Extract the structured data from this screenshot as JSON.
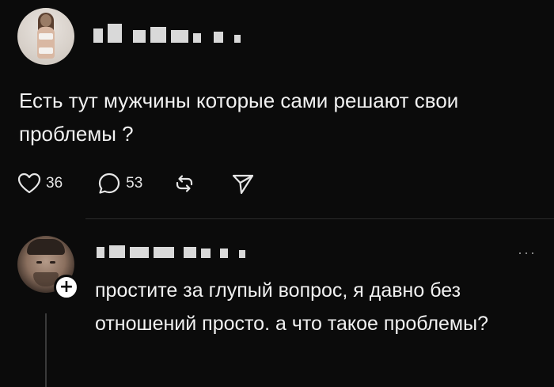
{
  "post": {
    "avatar_icon": "profile-photo",
    "text": "Есть тут мужчины которые сами решают свои проблемы ?",
    "actions": {
      "like_icon": "heart-icon",
      "like_count": "36",
      "comment_icon": "comment-bubble-icon",
      "comment_count": "53",
      "repost_icon": "repost-icon",
      "share_icon": "send-icon"
    }
  },
  "reply": {
    "avatar_icon": "profile-photo",
    "follow_icon": "plus-icon",
    "follow_label": "+",
    "more_label": "···",
    "text": "простите за глупый вопрос, я давно без отношений просто. а что такое проблемы?"
  },
  "colors": {
    "background": "#0b0b0b",
    "text": "#f1f1f1",
    "muted": "#9a9a9a",
    "divider": "#2b2b2b"
  }
}
